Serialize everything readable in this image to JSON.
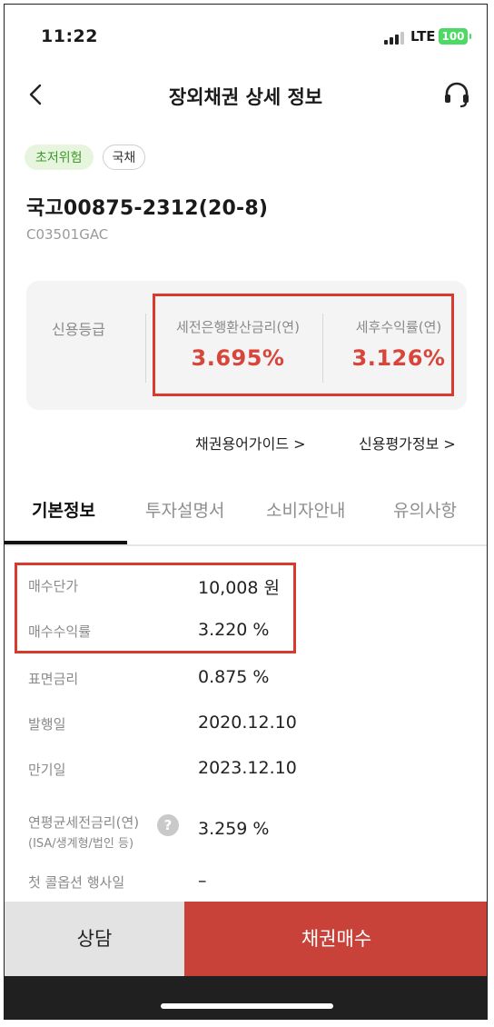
{
  "status_bar": {
    "time": "11:22",
    "network": "LTE",
    "battery": "100"
  },
  "header": {
    "title": "장외채권 상세 정보",
    "back_icon": "chevron-left-icon",
    "support_icon": "headset-icon"
  },
  "tags": {
    "risk": "초저위험",
    "type": "국채"
  },
  "bond": {
    "name": "국고00875-2312(20-8)",
    "code": "C03501GAC"
  },
  "card": {
    "credit_label": "신용등급",
    "pretax_label": "세전은행환산금리(연)",
    "pretax_value": "3.695%",
    "aftertax_label": "세후수익률(연)",
    "aftertax_value": "3.126%"
  },
  "links": {
    "guide": "채권용어가이드  >",
    "credit_info": "신용평가정보  >"
  },
  "tabs": [
    "기본정보",
    "투자설명서",
    "소비자안내",
    "유의사항"
  ],
  "details": [
    {
      "label": "매수단가",
      "value": "10,008 원"
    },
    {
      "label": "매수수익률",
      "value": "3.220 %"
    },
    {
      "label": "표면금리",
      "value": "0.875 %"
    },
    {
      "label": "발행일",
      "value": "2020.12.10"
    },
    {
      "label": "만기일",
      "value": "2023.12.10"
    },
    {
      "label": "연평균세전금리(연)",
      "sublabel": "(ISA/생계형/법인 등)",
      "value": "3.259 %"
    },
    {
      "label": "첫 콜옵션 행사일",
      "value": "–"
    }
  ],
  "buttons": {
    "consult": "상담",
    "buy": "채권매수"
  },
  "colors": {
    "accent_red": "#d8453b",
    "buy_button": "#c9423a",
    "risk_green": "#3c9a2a"
  }
}
